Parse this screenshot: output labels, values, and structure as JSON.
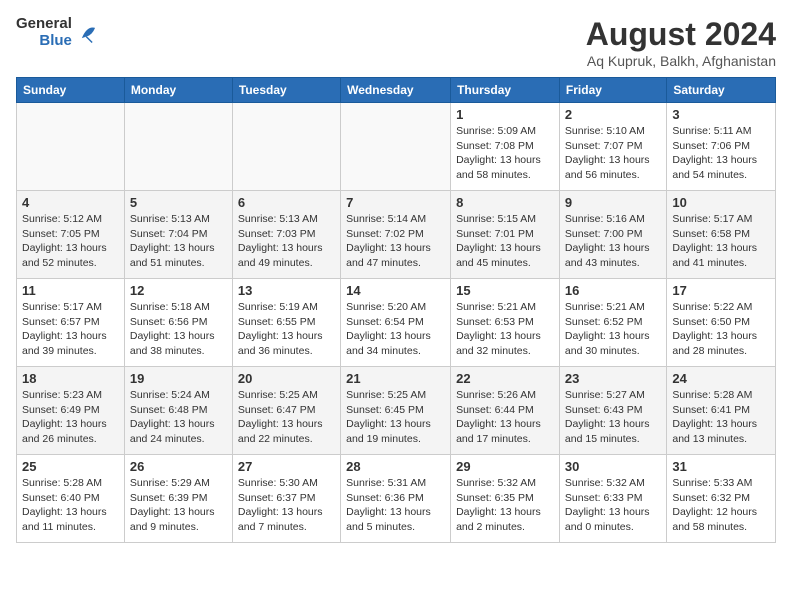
{
  "header": {
    "logo_general": "General",
    "logo_blue": "Blue",
    "title": "August 2024",
    "subtitle": "Aq Kupruk, Balkh, Afghanistan"
  },
  "days_of_week": [
    "Sunday",
    "Monday",
    "Tuesday",
    "Wednesday",
    "Thursday",
    "Friday",
    "Saturday"
  ],
  "weeks": [
    [
      {
        "day": "",
        "info": ""
      },
      {
        "day": "",
        "info": ""
      },
      {
        "day": "",
        "info": ""
      },
      {
        "day": "",
        "info": ""
      },
      {
        "day": "1",
        "info": "Sunrise: 5:09 AM\nSunset: 7:08 PM\nDaylight: 13 hours\nand 58 minutes."
      },
      {
        "day": "2",
        "info": "Sunrise: 5:10 AM\nSunset: 7:07 PM\nDaylight: 13 hours\nand 56 minutes."
      },
      {
        "day": "3",
        "info": "Sunrise: 5:11 AM\nSunset: 7:06 PM\nDaylight: 13 hours\nand 54 minutes."
      }
    ],
    [
      {
        "day": "4",
        "info": "Sunrise: 5:12 AM\nSunset: 7:05 PM\nDaylight: 13 hours\nand 52 minutes."
      },
      {
        "day": "5",
        "info": "Sunrise: 5:13 AM\nSunset: 7:04 PM\nDaylight: 13 hours\nand 51 minutes."
      },
      {
        "day": "6",
        "info": "Sunrise: 5:13 AM\nSunset: 7:03 PM\nDaylight: 13 hours\nand 49 minutes."
      },
      {
        "day": "7",
        "info": "Sunrise: 5:14 AM\nSunset: 7:02 PM\nDaylight: 13 hours\nand 47 minutes."
      },
      {
        "day": "8",
        "info": "Sunrise: 5:15 AM\nSunset: 7:01 PM\nDaylight: 13 hours\nand 45 minutes."
      },
      {
        "day": "9",
        "info": "Sunrise: 5:16 AM\nSunset: 7:00 PM\nDaylight: 13 hours\nand 43 minutes."
      },
      {
        "day": "10",
        "info": "Sunrise: 5:17 AM\nSunset: 6:58 PM\nDaylight: 13 hours\nand 41 minutes."
      }
    ],
    [
      {
        "day": "11",
        "info": "Sunrise: 5:17 AM\nSunset: 6:57 PM\nDaylight: 13 hours\nand 39 minutes."
      },
      {
        "day": "12",
        "info": "Sunrise: 5:18 AM\nSunset: 6:56 PM\nDaylight: 13 hours\nand 38 minutes."
      },
      {
        "day": "13",
        "info": "Sunrise: 5:19 AM\nSunset: 6:55 PM\nDaylight: 13 hours\nand 36 minutes."
      },
      {
        "day": "14",
        "info": "Sunrise: 5:20 AM\nSunset: 6:54 PM\nDaylight: 13 hours\nand 34 minutes."
      },
      {
        "day": "15",
        "info": "Sunrise: 5:21 AM\nSunset: 6:53 PM\nDaylight: 13 hours\nand 32 minutes."
      },
      {
        "day": "16",
        "info": "Sunrise: 5:21 AM\nSunset: 6:52 PM\nDaylight: 13 hours\nand 30 minutes."
      },
      {
        "day": "17",
        "info": "Sunrise: 5:22 AM\nSunset: 6:50 PM\nDaylight: 13 hours\nand 28 minutes."
      }
    ],
    [
      {
        "day": "18",
        "info": "Sunrise: 5:23 AM\nSunset: 6:49 PM\nDaylight: 13 hours\nand 26 minutes."
      },
      {
        "day": "19",
        "info": "Sunrise: 5:24 AM\nSunset: 6:48 PM\nDaylight: 13 hours\nand 24 minutes."
      },
      {
        "day": "20",
        "info": "Sunrise: 5:25 AM\nSunset: 6:47 PM\nDaylight: 13 hours\nand 22 minutes."
      },
      {
        "day": "21",
        "info": "Sunrise: 5:25 AM\nSunset: 6:45 PM\nDaylight: 13 hours\nand 19 minutes."
      },
      {
        "day": "22",
        "info": "Sunrise: 5:26 AM\nSunset: 6:44 PM\nDaylight: 13 hours\nand 17 minutes."
      },
      {
        "day": "23",
        "info": "Sunrise: 5:27 AM\nSunset: 6:43 PM\nDaylight: 13 hours\nand 15 minutes."
      },
      {
        "day": "24",
        "info": "Sunrise: 5:28 AM\nSunset: 6:41 PM\nDaylight: 13 hours\nand 13 minutes."
      }
    ],
    [
      {
        "day": "25",
        "info": "Sunrise: 5:28 AM\nSunset: 6:40 PM\nDaylight: 13 hours\nand 11 minutes."
      },
      {
        "day": "26",
        "info": "Sunrise: 5:29 AM\nSunset: 6:39 PM\nDaylight: 13 hours\nand 9 minutes."
      },
      {
        "day": "27",
        "info": "Sunrise: 5:30 AM\nSunset: 6:37 PM\nDaylight: 13 hours\nand 7 minutes."
      },
      {
        "day": "28",
        "info": "Sunrise: 5:31 AM\nSunset: 6:36 PM\nDaylight: 13 hours\nand 5 minutes."
      },
      {
        "day": "29",
        "info": "Sunrise: 5:32 AM\nSunset: 6:35 PM\nDaylight: 13 hours\nand 2 minutes."
      },
      {
        "day": "30",
        "info": "Sunrise: 5:32 AM\nSunset: 6:33 PM\nDaylight: 13 hours\nand 0 minutes."
      },
      {
        "day": "31",
        "info": "Sunrise: 5:33 AM\nSunset: 6:32 PM\nDaylight: 12 hours\nand 58 minutes."
      }
    ]
  ]
}
